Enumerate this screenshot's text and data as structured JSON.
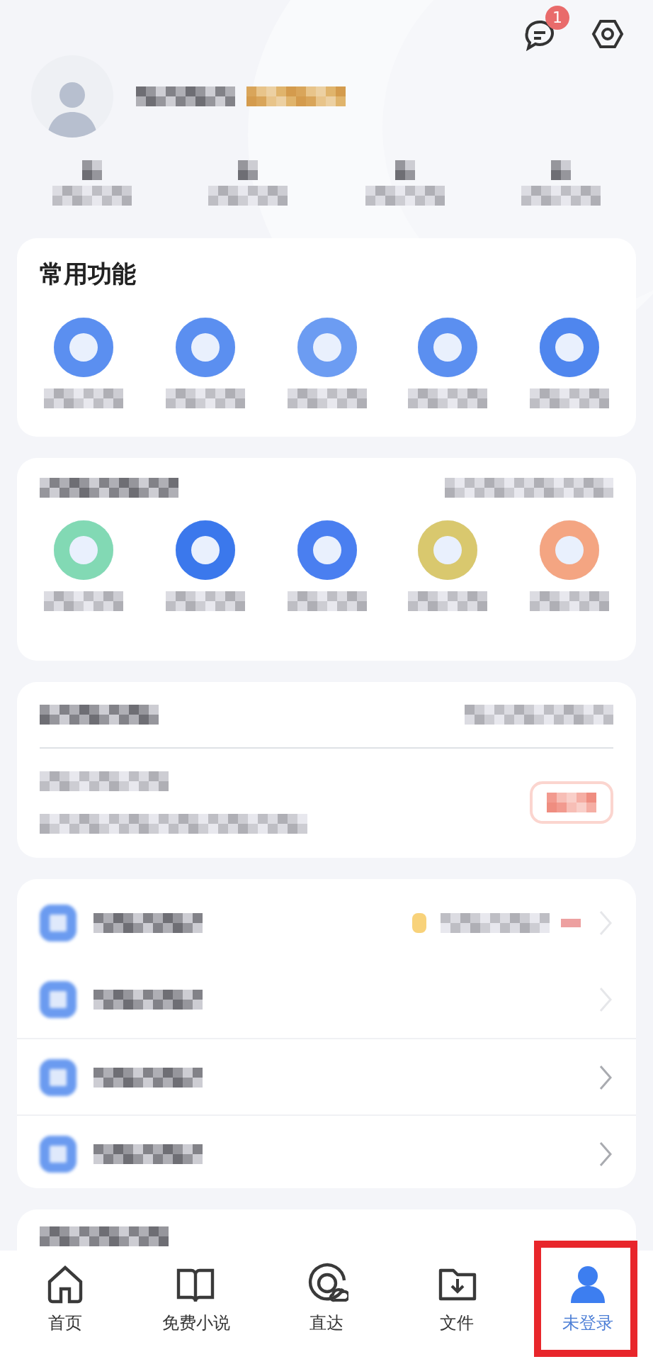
{
  "top_bar": {
    "message_badge": "1"
  },
  "quick_tools": {
    "title": "常用功能",
    "items": [
      {
        "color": "#5b8ff0"
      },
      {
        "color": "#5b8ff0"
      },
      {
        "color": "#6c9cf2"
      },
      {
        "color": "#5b8ff0"
      },
      {
        "color": "#4f86ee"
      }
    ]
  },
  "mini_programs": {
    "items": [
      {
        "color": "#82d9b4"
      },
      {
        "color": "#3b78ec"
      },
      {
        "color": "#4a7ff0"
      },
      {
        "color": "#d9c86e"
      },
      {
        "color": "#f4a582"
      }
    ]
  },
  "menu_rows": [
    {
      "kind": "promo"
    },
    {
      "kind": "plain"
    },
    {
      "kind": "link"
    },
    {
      "kind": "link"
    }
  ],
  "bottom_nav": [
    {
      "label": "首页",
      "selected": false
    },
    {
      "label": "免费小说",
      "selected": false
    },
    {
      "label": "直达",
      "selected": false
    },
    {
      "label": "文件",
      "selected": false
    },
    {
      "label": "未登录",
      "selected": true
    }
  ],
  "annotation": {
    "highlight_selected_tab": true
  }
}
